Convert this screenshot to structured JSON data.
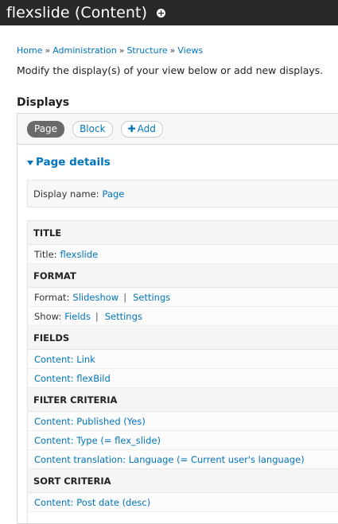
{
  "header": {
    "title": "flexslide (Content)"
  },
  "breadcrumb": [
    "Home",
    "Administration",
    "Structure",
    "Views"
  ],
  "breadcrumb_sep": "»",
  "help_text": "Modify the display(s) of your view below or add new displays.",
  "displays": {
    "heading": "Displays",
    "tabs": [
      {
        "label": "Page",
        "active": true
      },
      {
        "label": "Block",
        "active": false
      }
    ],
    "add_label": "Add",
    "details_toggle": "Page details",
    "display_name_label": "Display name:",
    "display_name_value": "Page"
  },
  "sections": {
    "title": {
      "heading": "TITLE",
      "label": "Title:",
      "value": "flexslide"
    },
    "format": {
      "heading": "FORMAT",
      "format_label": "Format:",
      "format_value": "Slideshow",
      "format_settings": "Settings",
      "show_label": "Show:",
      "show_value": "Fields",
      "show_settings": "Settings"
    },
    "fields": {
      "heading": "FIELDS",
      "items": [
        "Content: Link",
        "Content: flexBild"
      ]
    },
    "filter": {
      "heading": "FILTER CRITERIA",
      "items": [
        "Content: Published (Yes)",
        "Content: Type (= flex_slide)",
        "Content translation: Language (= Current user's language)"
      ]
    },
    "sort": {
      "heading": "SORT CRITERIA",
      "items": [
        "Content: Post date (desc)"
      ]
    }
  }
}
